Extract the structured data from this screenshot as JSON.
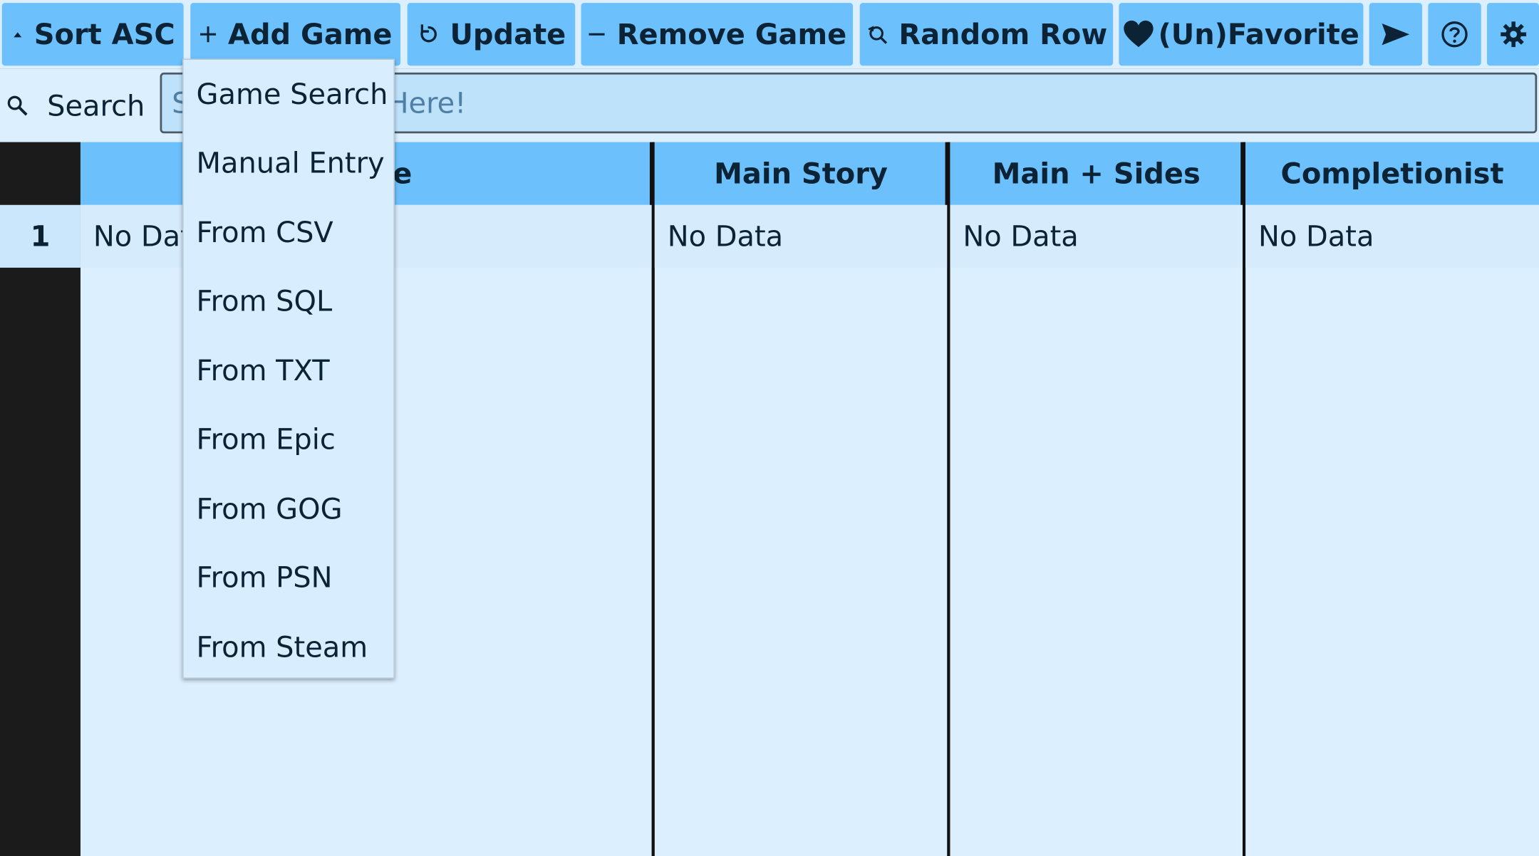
{
  "toolbar": {
    "sort_label": "Sort ASC",
    "add_label": "Add Game",
    "update_label": "Update",
    "remove_label": "Remove Game",
    "random_label": "Random Row",
    "favorite_label": "(Un)Favorite"
  },
  "search": {
    "label": "Search",
    "placeholder": "Search Games Here!"
  },
  "table": {
    "columns": [
      "Name",
      "Main Story",
      "Main + Sides",
      "Completionist"
    ],
    "rows": [
      {
        "num": "1",
        "cells": [
          "No Data",
          "No Data",
          "No Data",
          "No Data"
        ]
      }
    ]
  },
  "add_menu": {
    "items": [
      "Game Search",
      "Manual Entry",
      "From CSV",
      "From SQL",
      "From TXT",
      "From Epic",
      "From GOG",
      "From PSN",
      "From Steam"
    ]
  },
  "colors": {
    "button": "#6cc0fb",
    "background": "#dcefff",
    "header": "#6cc0fb"
  }
}
